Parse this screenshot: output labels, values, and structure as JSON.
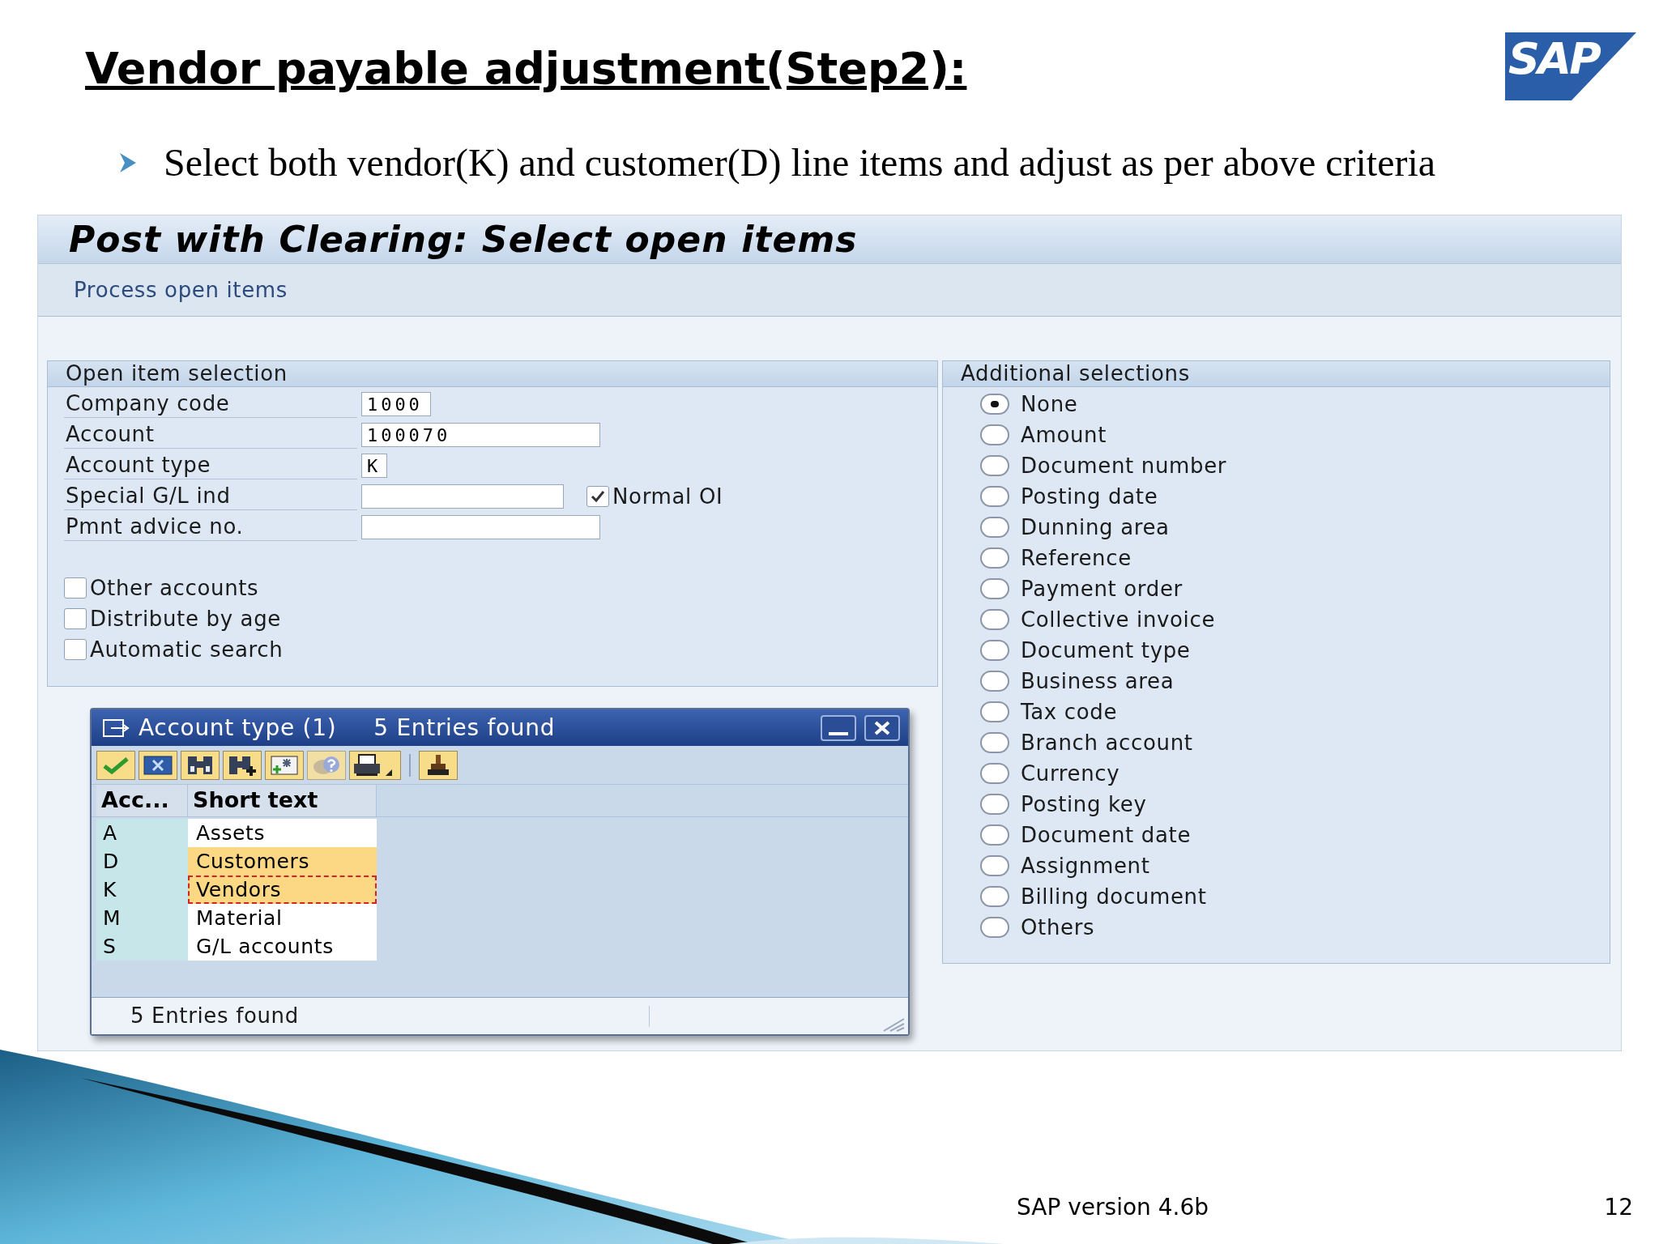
{
  "slide": {
    "title": "Vendor payable adjustment(Step2):",
    "logo": "SAP",
    "bullets": [
      "Select both vendor(K) and customer(D) line items and adjust as per above criteria"
    ],
    "footer": "SAP version 4.6b",
    "page_number": "12"
  },
  "screen": {
    "title": "Post with Clearing: Select open items",
    "toolbar": [
      "Process open items"
    ],
    "open_item_selection": {
      "title": "Open item selection",
      "fields": [
        {
          "label": "Company code",
          "value": "1000"
        },
        {
          "label": "Account",
          "value": "100070"
        },
        {
          "label": "Account type",
          "value": "K"
        },
        {
          "label": "Special G/L ind"
        },
        {
          "label": "Pmnt advice no."
        }
      ],
      "normal_oi": {
        "label": "Normal OI",
        "checked": true
      },
      "checkboxes": [
        {
          "label": "Other accounts",
          "checked": false
        },
        {
          "label": "Distribute by age",
          "checked": false
        },
        {
          "label": "Automatic search",
          "checked": false
        }
      ]
    },
    "additional_selections": {
      "title": "Additional selections",
      "options": [
        {
          "label": "None",
          "selected": true
        },
        {
          "label": "Amount",
          "selected": false
        },
        {
          "label": "Document number",
          "selected": false
        },
        {
          "label": "Posting date",
          "selected": false
        },
        {
          "label": "Dunning area",
          "selected": false
        },
        {
          "label": "Reference",
          "selected": false
        },
        {
          "label": "Payment order",
          "selected": false
        },
        {
          "label": "Collective invoice",
          "selected": false
        },
        {
          "label": "Document type",
          "selected": false
        },
        {
          "label": "Business area",
          "selected": false
        },
        {
          "label": "Tax code",
          "selected": false
        },
        {
          "label": "Branch account",
          "selected": false
        },
        {
          "label": "Currency",
          "selected": false
        },
        {
          "label": "Posting key",
          "selected": false
        },
        {
          "label": "Document date",
          "selected": false
        },
        {
          "label": "Assignment",
          "selected": false
        },
        {
          "label": "Billing document",
          "selected": false
        },
        {
          "label": "Others",
          "selected": false
        }
      ]
    },
    "popup": {
      "title": "Account type (1)",
      "subtitle": "5 Entries found",
      "columns": [
        "Acc...",
        "Short text"
      ],
      "rows": [
        {
          "key": "A",
          "text": "Assets",
          "selected": false,
          "focused": false
        },
        {
          "key": "D",
          "text": "Customers",
          "selected": true,
          "focused": false
        },
        {
          "key": "K",
          "text": "Vendors",
          "selected": true,
          "focused": true
        },
        {
          "key": "M",
          "text": "Material",
          "selected": false,
          "focused": false
        },
        {
          "key": "S",
          "text": "G/L accounts",
          "selected": false,
          "focused": false
        }
      ],
      "status": "5 Entries found"
    }
  }
}
